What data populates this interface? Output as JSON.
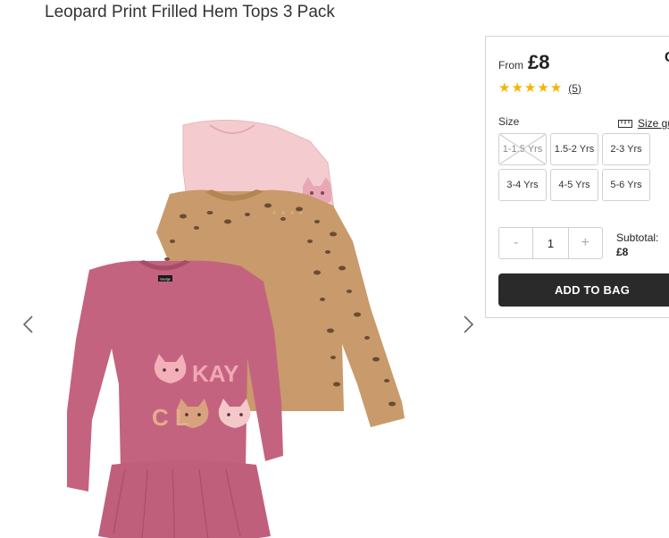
{
  "product": {
    "title": "Leopard Print Frilled Hem Tops 3 Pack",
    "image": {
      "front_top_print_line1": "KAY",
      "front_top_print_line2": "C L",
      "front_top_neck_label": "George"
    }
  },
  "price": {
    "from_label": "From",
    "value": "£8"
  },
  "rating": {
    "stars": 5,
    "max_stars": 5,
    "review_count": "(5)"
  },
  "size": {
    "label": "Size",
    "guide_label": "Size gu",
    "options": [
      {
        "label": "1-1.5 Yrs",
        "available": false
      },
      {
        "label": "1.5-2 Yrs",
        "available": true
      },
      {
        "label": "2-3 Yrs",
        "available": true
      },
      {
        "label": "3-4 Yrs",
        "available": true
      },
      {
        "label": "4-5 Yrs",
        "available": true
      },
      {
        "label": "5-6 Yrs",
        "available": true
      }
    ]
  },
  "quantity": {
    "decrement": "-",
    "value": "1",
    "increment": "+"
  },
  "subtotal": {
    "label": "Subtotal:",
    "value": "£8"
  },
  "add_to_bag": {
    "label": "ADD TO BAG"
  },
  "edge_glyph": "C",
  "colors": {
    "star": "#f5b400",
    "button_dark": "#2a2a2a",
    "border": "#d4d4d4",
    "shirt_front": "#c4637f",
    "shirt_middle": "#c99a6b",
    "shirt_back": "#f4ccd0"
  }
}
